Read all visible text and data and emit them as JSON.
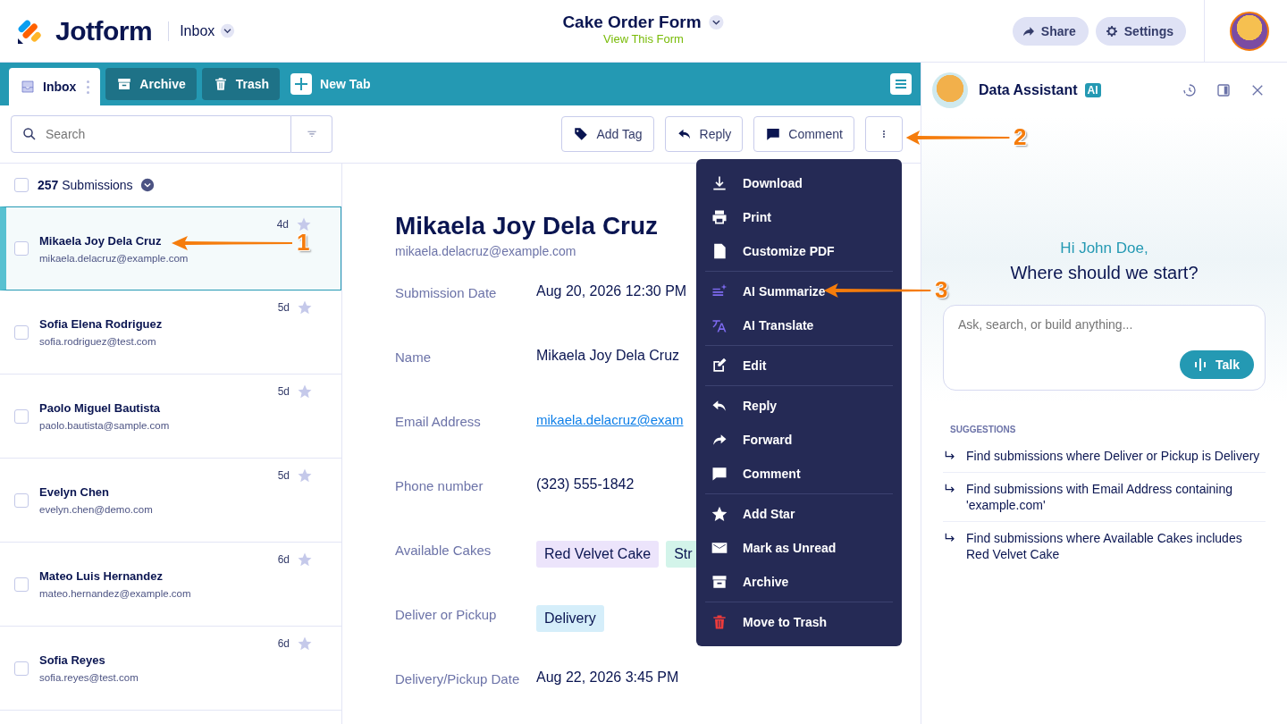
{
  "header": {
    "logo": "Jotform",
    "section": "Inbox",
    "form_title": "Cake Order Form",
    "form_link": "View This Form",
    "buttons": [
      {
        "label": "Share",
        "kind": "share"
      },
      {
        "label": "Settings",
        "kind": "gear"
      }
    ]
  },
  "tabs": [
    {
      "label": "Inbox",
      "kind": "inbox",
      "selected": true
    },
    {
      "label": "Archive",
      "kind": "archive",
      "selected": false
    },
    {
      "label": "Trash",
      "kind": "trash",
      "selected": false
    }
  ],
  "new_tab": "New Tab",
  "search": {
    "placeholder": "Search"
  },
  "actions": [
    {
      "label": "Add Tag",
      "kind": "tag"
    },
    {
      "label": "Reply",
      "kind": "reply"
    },
    {
      "label": "Comment",
      "kind": "comment"
    }
  ],
  "list": {
    "count": "257",
    "count_label": "Submissions",
    "checked": false,
    "items": [
      {
        "name": "Mikaela Joy Dela Cruz",
        "email": "mikaela.delacruz@example.com",
        "age": "4d",
        "selected": true,
        "checked": false,
        "starred": false
      },
      {
        "name": "Sofia Elena Rodriguez",
        "email": "sofia.rodriguez@test.com",
        "age": "5d",
        "selected": false,
        "checked": false,
        "starred": false
      },
      {
        "name": "Paolo Miguel Bautista",
        "email": "paolo.bautista@sample.com",
        "age": "5d",
        "selected": false,
        "checked": false,
        "starred": false
      },
      {
        "name": "Evelyn Chen",
        "email": "evelyn.chen@demo.com",
        "age": "5d",
        "selected": false,
        "checked": false,
        "starred": false
      },
      {
        "name": "Mateo Luis Hernandez",
        "email": "mateo.hernandez@example.com",
        "age": "6d",
        "selected": false,
        "checked": false,
        "starred": false
      },
      {
        "name": "Sofia Reyes",
        "email": "sofia.reyes@test.com",
        "age": "6d",
        "selected": false,
        "checked": false,
        "starred": false
      }
    ]
  },
  "detail": {
    "name": "Mikaela Joy Dela Cruz",
    "email": "mikaela.delacruz@example.com",
    "fields": [
      {
        "label": "Submission Date",
        "kind": "text",
        "value": "Aug 20, 2026 12:30 PM"
      },
      {
        "label": "Name",
        "kind": "text",
        "value": "Mikaela Joy Dela Cruz"
      },
      {
        "label": "Email Address",
        "kind": "link",
        "value": "mikaela.delacruz@exam"
      },
      {
        "label": "Phone number",
        "kind": "text",
        "value": "(323) 555-1842"
      },
      {
        "label": "Available Cakes",
        "kind": "tags",
        "tags": [
          {
            "text": "Red Velvet Cake",
            "color": "#ece4fb"
          },
          {
            "text": "Str",
            "color": "#d3f4ea"
          }
        ]
      },
      {
        "label": "Deliver or Pickup",
        "kind": "tags",
        "tags": [
          {
            "text": "Delivery",
            "color": "#d5eefa"
          }
        ]
      },
      {
        "label": "Delivery/Pickup Date",
        "kind": "text",
        "value": "Aug 22, 2026 3:45 PM"
      }
    ]
  },
  "menu": [
    [
      {
        "label": "Download",
        "kind": "download"
      },
      {
        "label": "Print",
        "kind": "print"
      },
      {
        "label": "Customize PDF",
        "kind": "pdf"
      }
    ],
    [
      {
        "label": "AI Summarize",
        "kind": "summarize"
      },
      {
        "label": "AI Translate",
        "kind": "translate"
      }
    ],
    [
      {
        "label": "Edit",
        "kind": "edit"
      }
    ],
    [
      {
        "label": "Reply",
        "kind": "reply"
      },
      {
        "label": "Forward",
        "kind": "forward"
      },
      {
        "label": "Comment",
        "kind": "comment"
      }
    ],
    [
      {
        "label": "Add Star",
        "kind": "star"
      },
      {
        "label": "Mark as Unread",
        "kind": "mail"
      },
      {
        "label": "Archive",
        "kind": "archive"
      }
    ],
    [
      {
        "label": "Move to Trash",
        "kind": "trash"
      }
    ]
  ],
  "assistant": {
    "title": "Data Assistant",
    "badge": "AI",
    "greeting": "Hi John Doe,",
    "prompt": "Where should we start?",
    "placeholder": "Ask, search, or build anything...",
    "talk": "Talk",
    "suggestions_heading": "SUGGESTIONS",
    "suggestions": [
      "Find submissions where Deliver or Pickup is Delivery",
      "Find submissions with Email Address containing 'example.com'",
      "Find submissions where Available Cakes includes Red Velvet Cake"
    ]
  },
  "annotations": [
    "1",
    "2",
    "3"
  ]
}
